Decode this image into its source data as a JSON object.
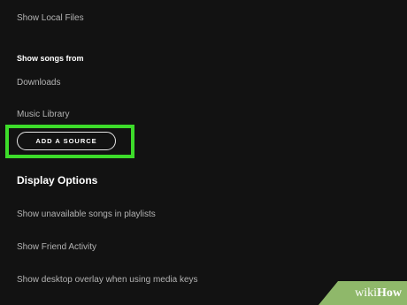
{
  "local_files": {
    "toggle_label": "Show Local Files"
  },
  "songs_from": {
    "heading": "Show songs from",
    "sources": [
      "Downloads",
      "Music Library"
    ],
    "add_button": "ADD A SOURCE"
  },
  "display_options": {
    "heading": "Display Options",
    "items": [
      "Show unavailable songs in playlists",
      "Show Friend Activity",
      "Show desktop overlay when using media keys"
    ]
  },
  "watermark": {
    "part1": "wiki",
    "part2": "How"
  },
  "colors": {
    "background": "#121212",
    "highlight": "#3ddc2a",
    "text_secondary": "#b3b3b3",
    "text_primary": "#ffffff"
  }
}
